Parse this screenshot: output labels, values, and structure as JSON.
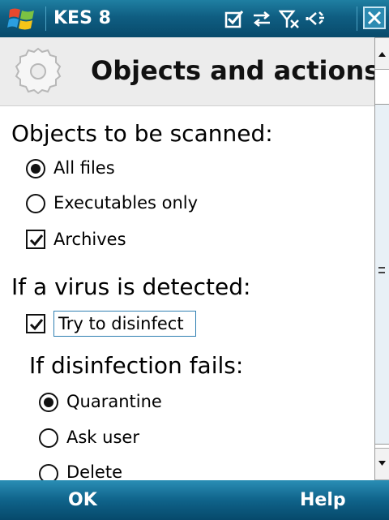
{
  "status_bar": {
    "app_title": "KES 8",
    "icons": [
      "windows-start-icon",
      "notification-check-icon",
      "sync-arrows-icon",
      "signal-off-icon",
      "volume-muted-icon",
      "close-icon"
    ]
  },
  "header": {
    "title": "Objects and actions",
    "icon": "gear-icon"
  },
  "scan_objects": {
    "title": "Objects to be scanned:",
    "options": [
      {
        "label": "All files",
        "type": "radio",
        "checked": true
      },
      {
        "label": "Executables only",
        "type": "radio",
        "checked": false
      },
      {
        "label": "Archives",
        "type": "checkbox",
        "checked": true
      }
    ]
  },
  "virus_detected": {
    "title": "If a virus is detected:",
    "option": {
      "label": "Try to disinfect",
      "type": "checkbox",
      "checked": true
    }
  },
  "disinfection_fails": {
    "title": "If disinfection fails:",
    "options": [
      {
        "label": "Quarantine",
        "type": "radio",
        "checked": true
      },
      {
        "label": "Ask user",
        "type": "radio",
        "checked": false
      },
      {
        "label": "Delete",
        "type": "radio",
        "checked": false
      }
    ]
  },
  "softkeys": {
    "left": "OK",
    "right": "Help"
  },
  "colors": {
    "bar_top": "#1f7fa2",
    "bar_bottom": "#084a6b",
    "header_bg": "#ececec",
    "focus_border": "#2f7fb2"
  }
}
